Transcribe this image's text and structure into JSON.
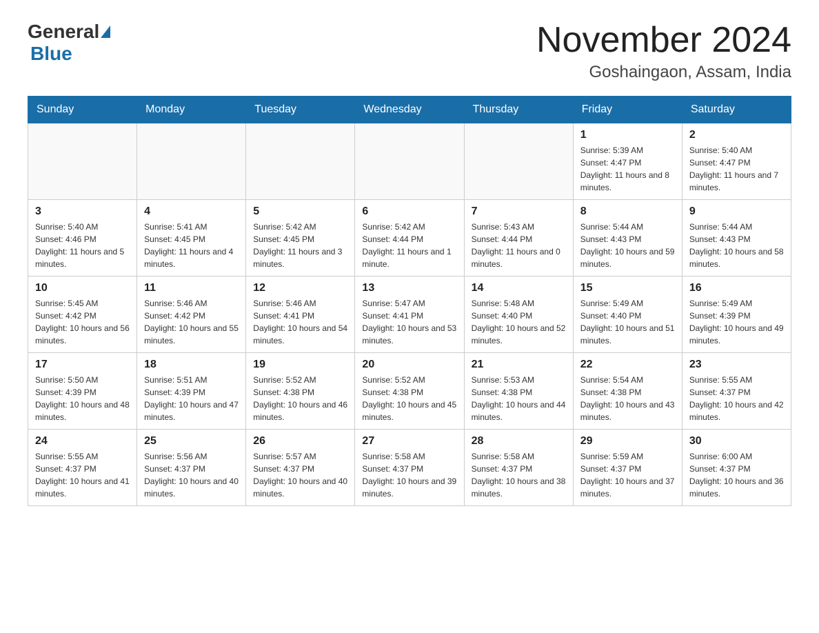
{
  "header": {
    "logo_general": "General",
    "logo_blue": "Blue",
    "month_title": "November 2024",
    "location": "Goshaingaon, Assam, India"
  },
  "weekdays": [
    "Sunday",
    "Monday",
    "Tuesday",
    "Wednesday",
    "Thursday",
    "Friday",
    "Saturday"
  ],
  "weeks": [
    [
      {
        "day": "",
        "info": ""
      },
      {
        "day": "",
        "info": ""
      },
      {
        "day": "",
        "info": ""
      },
      {
        "day": "",
        "info": ""
      },
      {
        "day": "",
        "info": ""
      },
      {
        "day": "1",
        "info": "Sunrise: 5:39 AM\nSunset: 4:47 PM\nDaylight: 11 hours and 8 minutes."
      },
      {
        "day": "2",
        "info": "Sunrise: 5:40 AM\nSunset: 4:47 PM\nDaylight: 11 hours and 7 minutes."
      }
    ],
    [
      {
        "day": "3",
        "info": "Sunrise: 5:40 AM\nSunset: 4:46 PM\nDaylight: 11 hours and 5 minutes."
      },
      {
        "day": "4",
        "info": "Sunrise: 5:41 AM\nSunset: 4:45 PM\nDaylight: 11 hours and 4 minutes."
      },
      {
        "day": "5",
        "info": "Sunrise: 5:42 AM\nSunset: 4:45 PM\nDaylight: 11 hours and 3 minutes."
      },
      {
        "day": "6",
        "info": "Sunrise: 5:42 AM\nSunset: 4:44 PM\nDaylight: 11 hours and 1 minute."
      },
      {
        "day": "7",
        "info": "Sunrise: 5:43 AM\nSunset: 4:44 PM\nDaylight: 11 hours and 0 minutes."
      },
      {
        "day": "8",
        "info": "Sunrise: 5:44 AM\nSunset: 4:43 PM\nDaylight: 10 hours and 59 minutes."
      },
      {
        "day": "9",
        "info": "Sunrise: 5:44 AM\nSunset: 4:43 PM\nDaylight: 10 hours and 58 minutes."
      }
    ],
    [
      {
        "day": "10",
        "info": "Sunrise: 5:45 AM\nSunset: 4:42 PM\nDaylight: 10 hours and 56 minutes."
      },
      {
        "day": "11",
        "info": "Sunrise: 5:46 AM\nSunset: 4:42 PM\nDaylight: 10 hours and 55 minutes."
      },
      {
        "day": "12",
        "info": "Sunrise: 5:46 AM\nSunset: 4:41 PM\nDaylight: 10 hours and 54 minutes."
      },
      {
        "day": "13",
        "info": "Sunrise: 5:47 AM\nSunset: 4:41 PM\nDaylight: 10 hours and 53 minutes."
      },
      {
        "day": "14",
        "info": "Sunrise: 5:48 AM\nSunset: 4:40 PM\nDaylight: 10 hours and 52 minutes."
      },
      {
        "day": "15",
        "info": "Sunrise: 5:49 AM\nSunset: 4:40 PM\nDaylight: 10 hours and 51 minutes."
      },
      {
        "day": "16",
        "info": "Sunrise: 5:49 AM\nSunset: 4:39 PM\nDaylight: 10 hours and 49 minutes."
      }
    ],
    [
      {
        "day": "17",
        "info": "Sunrise: 5:50 AM\nSunset: 4:39 PM\nDaylight: 10 hours and 48 minutes."
      },
      {
        "day": "18",
        "info": "Sunrise: 5:51 AM\nSunset: 4:39 PM\nDaylight: 10 hours and 47 minutes."
      },
      {
        "day": "19",
        "info": "Sunrise: 5:52 AM\nSunset: 4:38 PM\nDaylight: 10 hours and 46 minutes."
      },
      {
        "day": "20",
        "info": "Sunrise: 5:52 AM\nSunset: 4:38 PM\nDaylight: 10 hours and 45 minutes."
      },
      {
        "day": "21",
        "info": "Sunrise: 5:53 AM\nSunset: 4:38 PM\nDaylight: 10 hours and 44 minutes."
      },
      {
        "day": "22",
        "info": "Sunrise: 5:54 AM\nSunset: 4:38 PM\nDaylight: 10 hours and 43 minutes."
      },
      {
        "day": "23",
        "info": "Sunrise: 5:55 AM\nSunset: 4:37 PM\nDaylight: 10 hours and 42 minutes."
      }
    ],
    [
      {
        "day": "24",
        "info": "Sunrise: 5:55 AM\nSunset: 4:37 PM\nDaylight: 10 hours and 41 minutes."
      },
      {
        "day": "25",
        "info": "Sunrise: 5:56 AM\nSunset: 4:37 PM\nDaylight: 10 hours and 40 minutes."
      },
      {
        "day": "26",
        "info": "Sunrise: 5:57 AM\nSunset: 4:37 PM\nDaylight: 10 hours and 40 minutes."
      },
      {
        "day": "27",
        "info": "Sunrise: 5:58 AM\nSunset: 4:37 PM\nDaylight: 10 hours and 39 minutes."
      },
      {
        "day": "28",
        "info": "Sunrise: 5:58 AM\nSunset: 4:37 PM\nDaylight: 10 hours and 38 minutes."
      },
      {
        "day": "29",
        "info": "Sunrise: 5:59 AM\nSunset: 4:37 PM\nDaylight: 10 hours and 37 minutes."
      },
      {
        "day": "30",
        "info": "Sunrise: 6:00 AM\nSunset: 4:37 PM\nDaylight: 10 hours and 36 minutes."
      }
    ]
  ]
}
